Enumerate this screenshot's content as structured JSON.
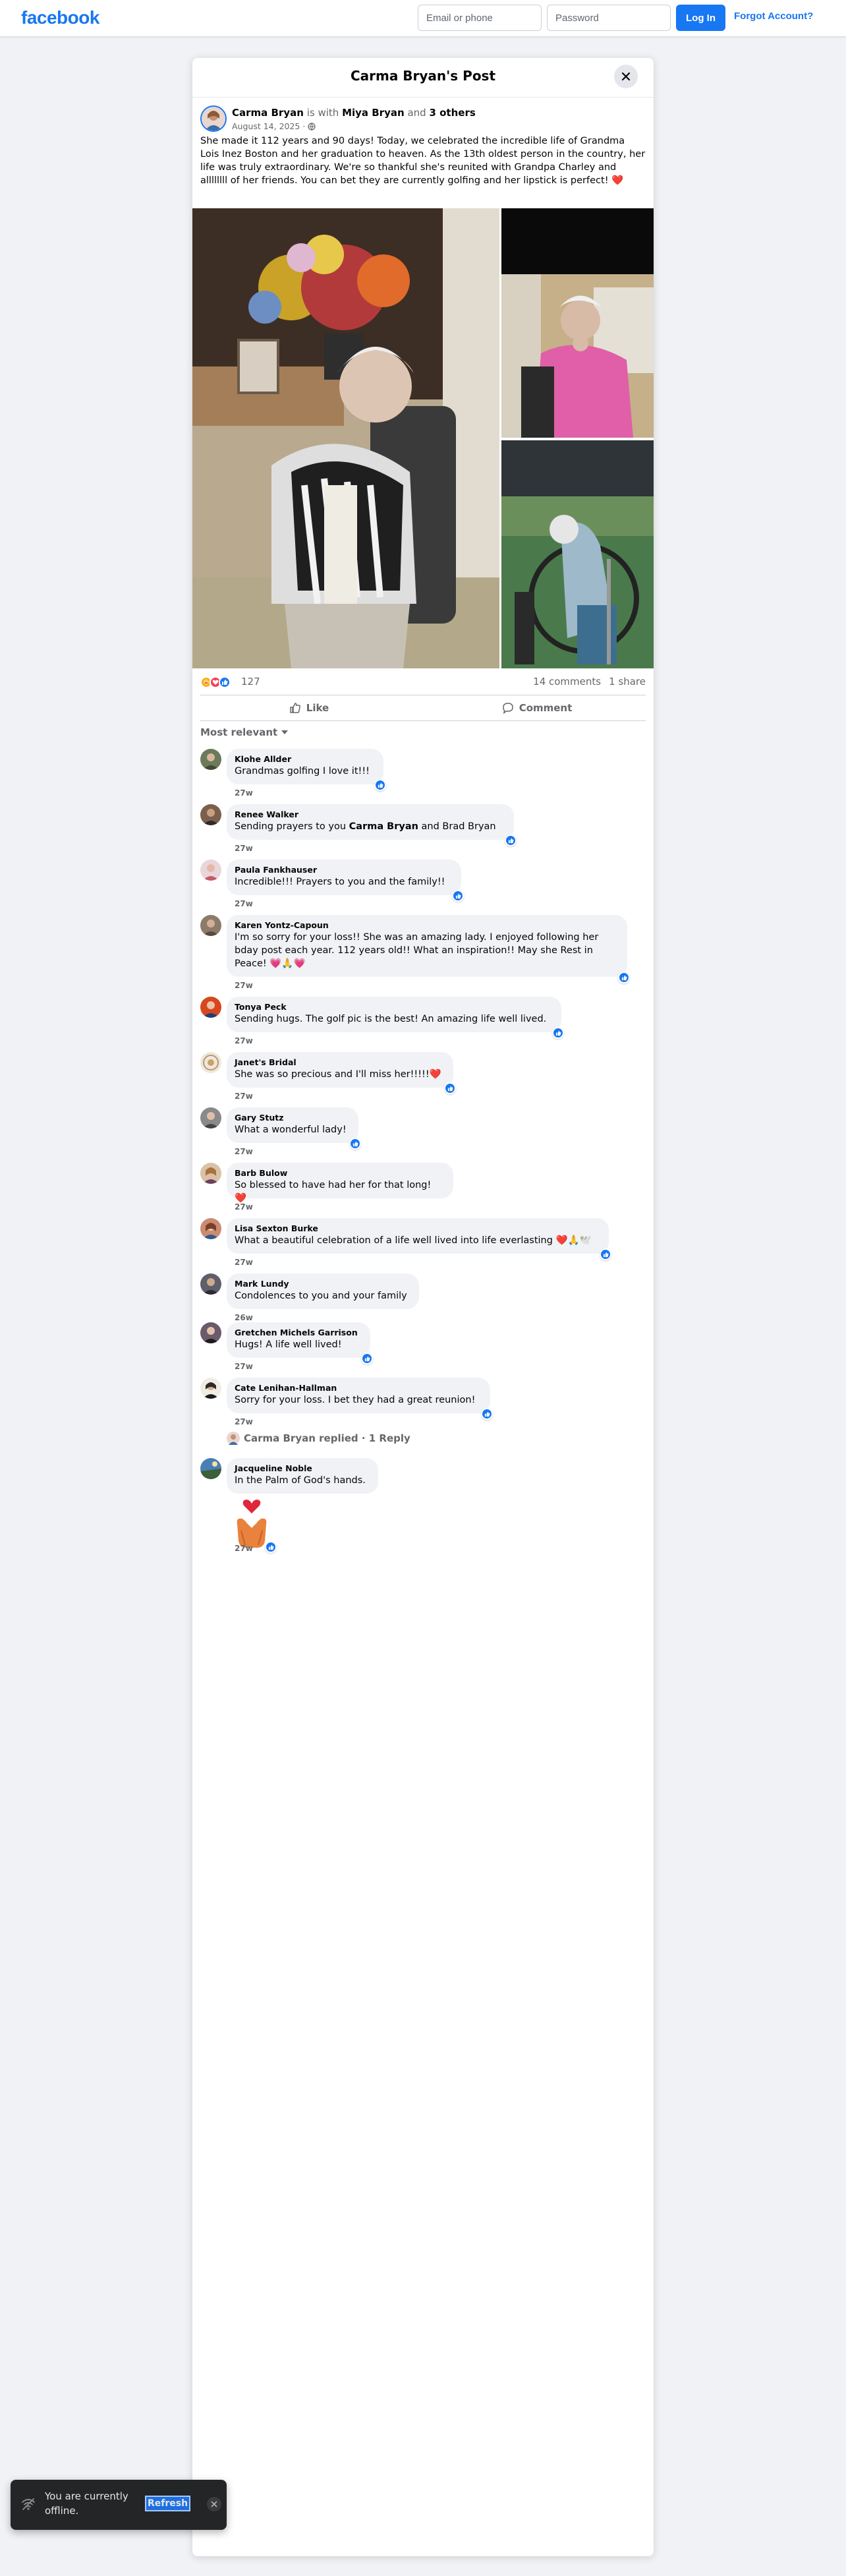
{
  "topbar": {
    "logo": "facebook",
    "email_placeholder": "Email or phone",
    "password_placeholder": "Password",
    "login_label": "Log In",
    "forgot_label": "Forgot Account?"
  },
  "post": {
    "dialog_title": "Carma Bryan's Post",
    "author": "Carma Bryan",
    "with_text": "is with",
    "tagged": "Miya Bryan",
    "and_text": "and",
    "others": "3 others",
    "date": "August 14, 2025",
    "date_separator": "·",
    "text": "She made it 112 years and 90 days!  Today, we celebrated the incredible life of Grandma Lois Inez Boston and her graduation to heaven. As the 13th oldest person in the country, her life was truly extraordinary. We're so thankful she's reunited with Grandpa Charley and allllllll of her friends. You can bet they are currently golfing and her lipstick is perfect! ❤️",
    "reaction_count": "127",
    "comments_count": "14 comments",
    "shares_count": "1 share",
    "like_label": "Like",
    "comment_label": "Comment",
    "sort_label": "Most relevant"
  },
  "comments": [
    {
      "name": "Klohe Allder",
      "text": "Grandmas golfing I love it!!!",
      "time": "27w",
      "reaction": "like"
    },
    {
      "name": "Renee Walker",
      "text_pre": "Sending prayers to you ",
      "text_bold": "Carma Bryan",
      "text_post": " and Brad Bryan",
      "time": "27w",
      "reaction": "like"
    },
    {
      "name": "Paula Fankhauser",
      "text": "Incredible!!! Prayers to you and the family!!",
      "time": "27w",
      "reaction": "like"
    },
    {
      "name": "Karen Yontz-Capoun",
      "text": "I'm so sorry for your loss!! She was an amazing lady. I enjoyed following her bday post each year. 112 years old!! What an inspiration!! May she Rest in Peace! 💗🙏💗",
      "time": "27w",
      "reaction": "like"
    },
    {
      "name": "Tonya Peck",
      "text": "Sending hugs. The golf pic is the best! An amazing life well lived.",
      "time": "27w",
      "reaction": "like"
    },
    {
      "name": "Janet's Bridal",
      "text": "She was so precious and I'll miss her!!!!!❤️",
      "time": "27w",
      "reaction": "like"
    },
    {
      "name": "Gary Stutz",
      "text": "What a wonderful lady!",
      "time": "27w",
      "reaction": "like"
    },
    {
      "name": "Barb Bulow",
      "text": "So blessed to have had her for that long! ❤️",
      "time": "27w",
      "reaction": "like"
    },
    {
      "name": "Lisa Sexton Burke",
      "text": "What a beautiful celebration of a life well lived into life everlasting ❤️🙏🕊️",
      "time": "27w",
      "reaction": "like"
    },
    {
      "name": "Mark Lundy",
      "text": "Condolences to you and your family",
      "time": "26w",
      "reaction": ""
    },
    {
      "name": "Gretchen Michels Garrison",
      "text": "Hugs! A life well lived!",
      "time": "27w",
      "reaction": "like"
    },
    {
      "name": "Cate Lenihan-Hallman",
      "text": "Sorry for your loss. I bet they had a great reunion!",
      "time": "27w",
      "reaction": "like"
    }
  ],
  "replies_label": "Carma Bryan replied · 1 Reply",
  "last_comment": {
    "name": "Jacqueline Noble",
    "text": "In the Palm of God's hands.",
    "time": "27w"
  },
  "toast": {
    "text": "You are currently offline.",
    "refresh_label": "Refresh"
  },
  "colors": {
    "brand": "#1877f2",
    "like": "#1877f2",
    "love": "#f33e58",
    "care": "#f7b125"
  }
}
